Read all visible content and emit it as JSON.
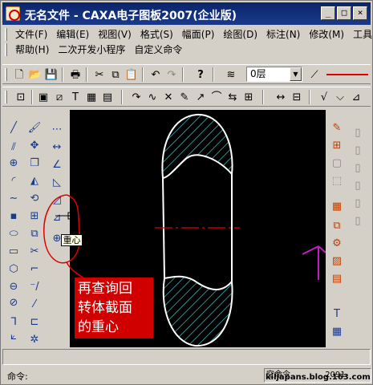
{
  "window": {
    "title": "无名文件 - CAXA电子图板2007(企业版)",
    "buttons": {
      "minimize": "_",
      "maximize": "□",
      "close": "×"
    }
  },
  "menu": {
    "row1": [
      "文件(F)",
      "编辑(E)",
      "视图(V)",
      "格式(S)",
      "幅面(P)",
      "绘图(D)",
      "标注(N)",
      "修改(M)",
      "工具(T)"
    ],
    "row2": [
      "帮助(H)",
      "二次开发小程序",
      "自定义命令"
    ]
  },
  "toolbar": {
    "layer_value": "0层",
    "line_color": "#e00000"
  },
  "tooltip": {
    "text": "重心"
  },
  "annotation": {
    "text_lines": [
      "再查询回",
      "转体截面",
      "的重心"
    ]
  },
  "status": {
    "command_label": "命令:",
    "right_text": "空命令",
    "coords": "2091",
    "watermark": "kiljapans.blog.163.com"
  },
  "colors": {
    "titlebar": "#0a246a",
    "canvas": "#000000",
    "hatch": "#40c8c8",
    "outline": "#ffffff",
    "centerline": "#e00000",
    "annotation_bg": "#d00000"
  }
}
